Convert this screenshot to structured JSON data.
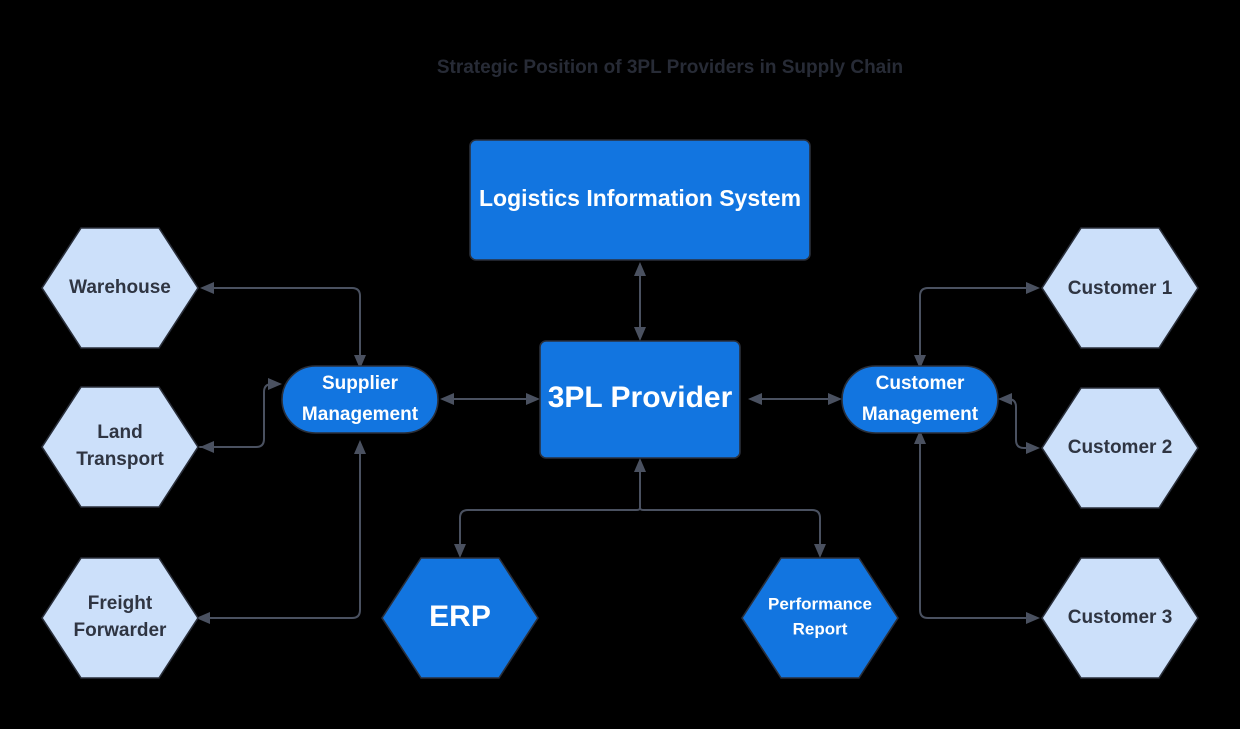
{
  "diagram": {
    "title": "Strategic Position of 3PL Providers in Supply Chain",
    "type": "flowchart",
    "background_color": "#000000",
    "colors": {
      "primary_fill": "#1275e0",
      "primary_text": "#ffffff",
      "soft_fill": "#cce0fa",
      "soft_text": "#2f3542",
      "node_stroke": "#2a2f3a",
      "edge_stroke": "#4a5160",
      "title_text": "#272b36"
    },
    "nodes": [
      {
        "id": "lis",
        "label": "Logistics Information System",
        "shape": "rounded-rect",
        "style": "primary",
        "text_size": "lg"
      },
      {
        "id": "tpl",
        "label": "3PL Provider",
        "shape": "rounded-rect",
        "style": "primary",
        "text_size": "xl"
      },
      {
        "id": "supplier",
        "label_line1": "Supplier",
        "label_line2": "Management",
        "shape": "stadium",
        "style": "primary",
        "text_size": "md"
      },
      {
        "id": "customer",
        "label_line1": "Customer",
        "label_line2": "Management",
        "shape": "stadium",
        "style": "primary",
        "text_size": "md"
      },
      {
        "id": "erp",
        "label": "ERP",
        "shape": "hexagon",
        "style": "primary",
        "text_size": "xl"
      },
      {
        "id": "perf",
        "label_line1": "Performance",
        "label_line2": "Report",
        "shape": "hexagon",
        "style": "primary",
        "text_size": "sm"
      },
      {
        "id": "warehouse",
        "label": "Warehouse",
        "shape": "hexagon",
        "style": "soft",
        "text_size": "md"
      },
      {
        "id": "land",
        "label_line1": "Land",
        "label_line2": "Transport",
        "shape": "hexagon",
        "style": "soft",
        "text_size": "md"
      },
      {
        "id": "freight",
        "label_line1": "Freight",
        "label_line2": "Forwarder",
        "shape": "hexagon",
        "style": "soft",
        "text_size": "md"
      },
      {
        "id": "cust1",
        "label": "Customer 1",
        "shape": "hexagon",
        "style": "soft",
        "text_size": "md"
      },
      {
        "id": "cust2",
        "label": "Customer 2",
        "shape": "hexagon",
        "style": "soft",
        "text_size": "md"
      },
      {
        "id": "cust3",
        "label": "Customer 3",
        "shape": "hexagon",
        "style": "soft",
        "text_size": "md"
      }
    ],
    "edges": [
      {
        "from": "lis",
        "to": "tpl",
        "direction": "both"
      },
      {
        "from": "supplier",
        "to": "tpl",
        "direction": "both"
      },
      {
        "from": "tpl",
        "to": "customer",
        "direction": "both"
      },
      {
        "from": "supplier",
        "to": "warehouse",
        "direction": "one"
      },
      {
        "from": "land",
        "to": "supplier",
        "direction": "one"
      },
      {
        "from": "supplier",
        "to": "land",
        "direction": "one"
      },
      {
        "from": "freight",
        "to": "supplier",
        "direction": "one"
      },
      {
        "from": "supplier",
        "to": "freight",
        "direction": "one"
      },
      {
        "from": "tpl",
        "to": "erp",
        "direction": "one"
      },
      {
        "from": "tpl",
        "to": "perf",
        "direction": "one"
      },
      {
        "from": "customer",
        "to": "cust1",
        "direction": "one"
      },
      {
        "from": "cust1",
        "to": "customer",
        "direction": "one"
      },
      {
        "from": "customer",
        "to": "cust2",
        "direction": "one"
      },
      {
        "from": "cust2",
        "to": "customer",
        "direction": "one"
      },
      {
        "from": "customer",
        "to": "cust3",
        "direction": "one"
      },
      {
        "from": "cust3",
        "to": "customer",
        "direction": "one"
      }
    ]
  }
}
